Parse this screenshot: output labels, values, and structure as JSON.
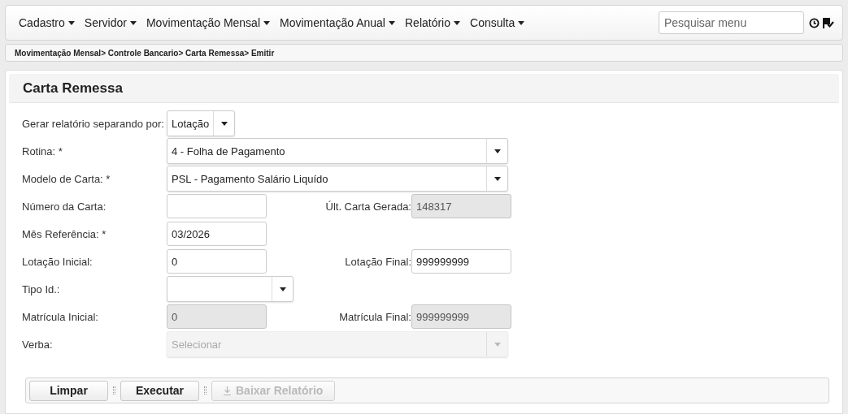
{
  "menu": [
    {
      "label": "Cadastro"
    },
    {
      "label": "Servidor"
    },
    {
      "label": "Movimentação Mensal"
    },
    {
      "label": "Movimentação Anual"
    },
    {
      "label": "Relatório"
    },
    {
      "label": "Consulta"
    }
  ],
  "search": {
    "placeholder": "Pesquisar menu"
  },
  "breadcrumb": "Movimentação Mensal> Controle Bancario> Carta Remessa> Emitir",
  "panel": {
    "title": "Carta Remessa"
  },
  "form": [
    {
      "label": "Gerar relatório separando por:",
      "kind": "select-short",
      "value": "Lotação",
      "disabled": false
    },
    {
      "label": "Rotina: *",
      "kind": "select-wide",
      "value": "4 - Folha de Pagamento",
      "disabled": false
    },
    {
      "label": "Modelo de Carta: *",
      "kind": "select-wide",
      "value": "PSL - Pagamento Salário Liquído",
      "disabled": false
    },
    {
      "label": "Número da Carta:",
      "kind": "input",
      "disabled": false,
      "right": {
        "label": "Últ. Carta Gerada:",
        "value": "148317",
        "disabled": true
      }
    },
    {
      "label": "Mês Referência: *",
      "kind": "input",
      "value": "03/2026",
      "disabled": false
    },
    {
      "label": "Lotação Inicial:",
      "kind": "input",
      "value": "0",
      "disabled": false,
      "right": {
        "label": "Lotação Final:",
        "value": "999999999",
        "disabled": false
      }
    },
    {
      "label": "Tipo Id.:",
      "kind": "select-short",
      "disabled": false
    },
    {
      "label": "Matrícula Inicial:",
      "kind": "input",
      "value": "0",
      "disabled": true,
      "right": {
        "label": "Matrícula Final:",
        "value": "999999999",
        "disabled": true
      }
    },
    {
      "label": "Verba:",
      "kind": "select-wide",
      "placeholder": "Selecionar",
      "disabled": true
    }
  ],
  "buttons": [
    {
      "label": "Limpar",
      "disabled": false,
      "icon": false
    },
    {
      "label": "Executar",
      "disabled": false,
      "icon": false
    },
    {
      "label": "Baixar Relatório",
      "disabled": true,
      "icon": true
    }
  ]
}
